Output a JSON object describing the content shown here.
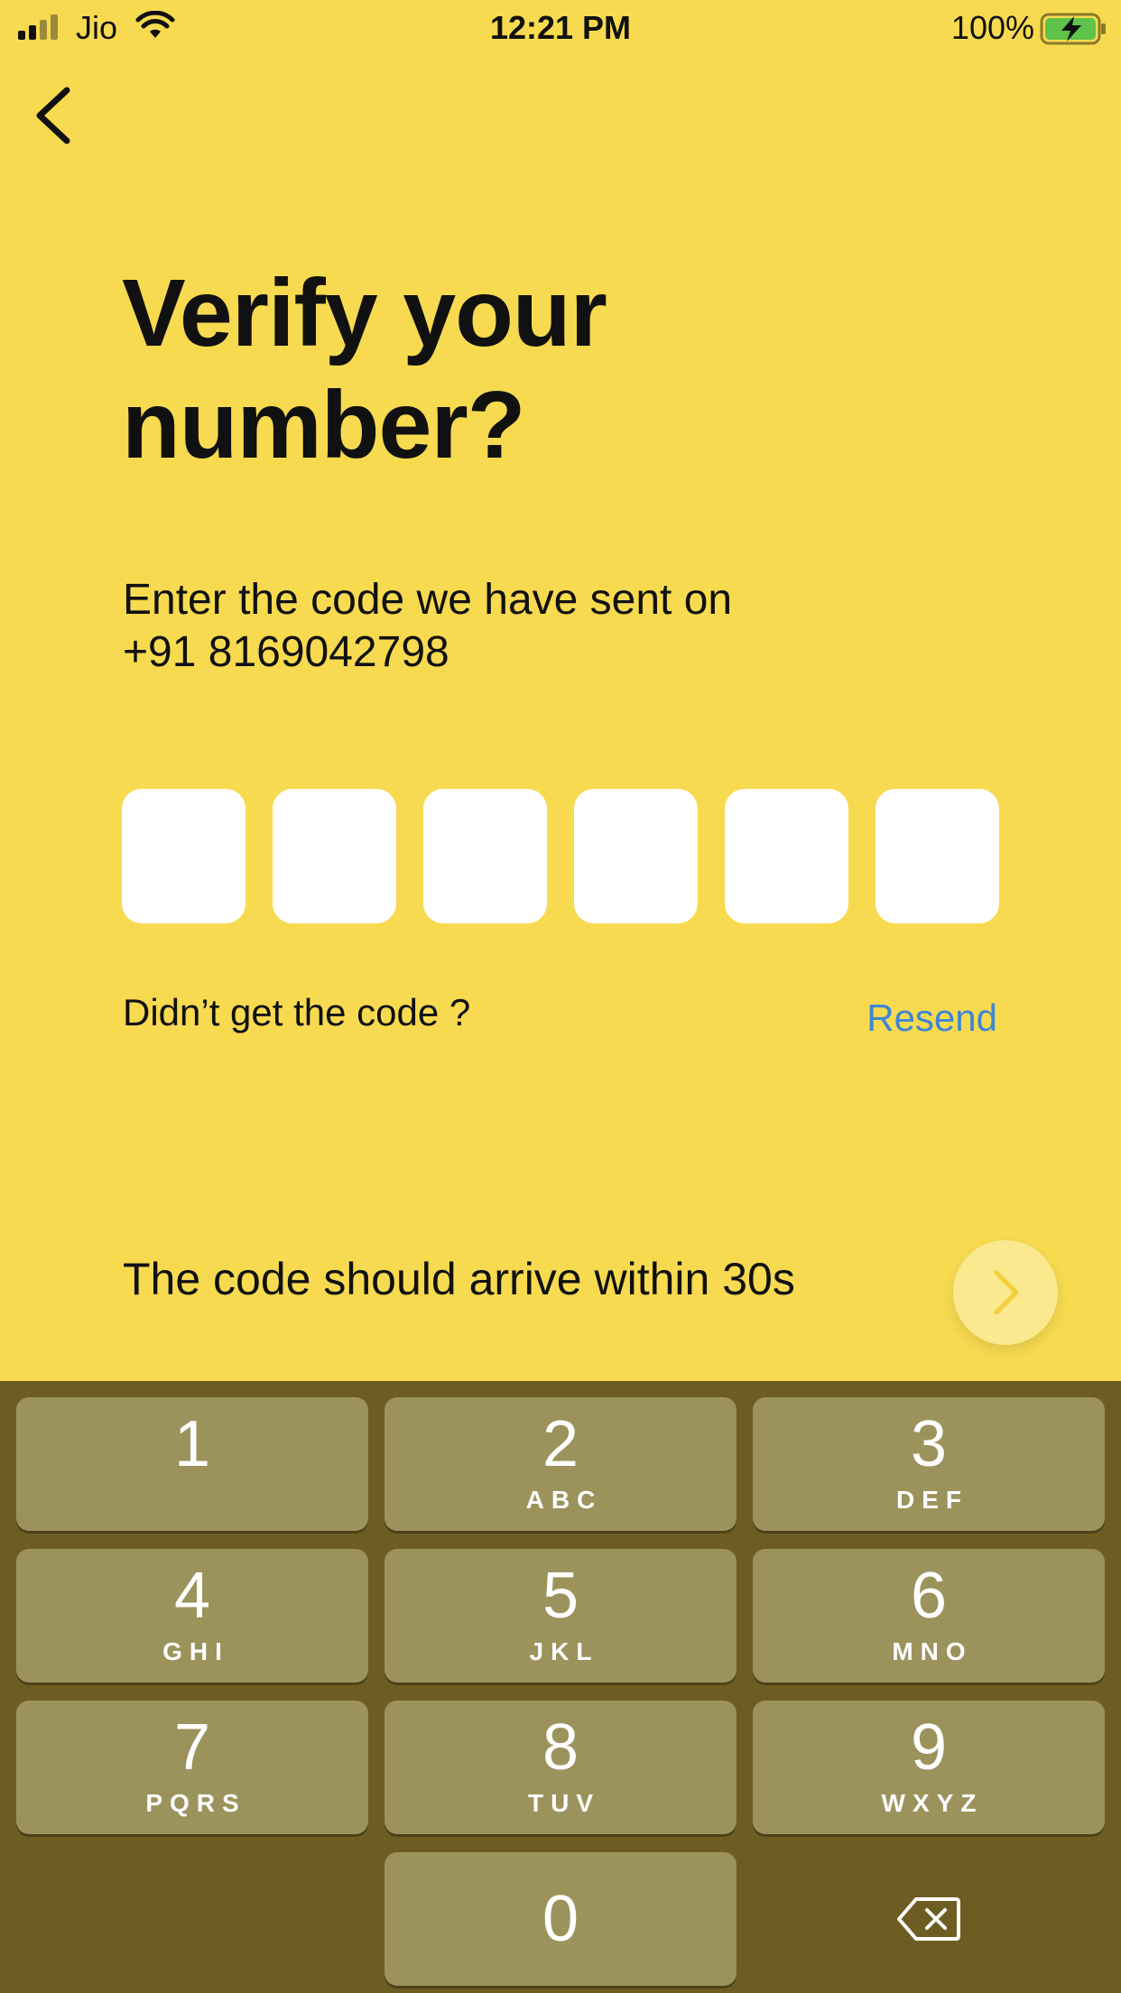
{
  "status_bar": {
    "carrier": "Jio",
    "time": "12:21 PM",
    "battery": "100%",
    "icons": [
      "signal-icon",
      "wifi-icon",
      "battery-charging-icon"
    ]
  },
  "nav": {
    "back_icon": "chevron-left-icon"
  },
  "colors": {
    "background": "#f7da50",
    "keypad": "#6e5d22",
    "key": "#9c935c",
    "link": "#3f86d4",
    "next_button": "#fae98f"
  },
  "title": "Verify your number?",
  "subtitle_line1": "Enter the code we have sent on",
  "subtitle_line2": "+91 8169042798",
  "otp": {
    "digits": [
      "",
      "",
      "",
      "",
      "",
      ""
    ]
  },
  "didnt_get": "Didn’t get the code ?",
  "resend": "Resend",
  "arrive_text": "The code should arrive within 30s",
  "next_icon": "chevron-right-icon",
  "keypad": {
    "keys": [
      {
        "num": "1",
        "letters": ""
      },
      {
        "num": "2",
        "letters": "ABC"
      },
      {
        "num": "3",
        "letters": "DEF"
      },
      {
        "num": "4",
        "letters": "GHI"
      },
      {
        "num": "5",
        "letters": "JKL"
      },
      {
        "num": "6",
        "letters": "MNO"
      },
      {
        "num": "7",
        "letters": "PQRS"
      },
      {
        "num": "8",
        "letters": "TUV"
      },
      {
        "num": "9",
        "letters": "WXYZ"
      },
      {
        "num": "0",
        "letters": ""
      }
    ],
    "backspace_icon": "backspace-icon"
  }
}
